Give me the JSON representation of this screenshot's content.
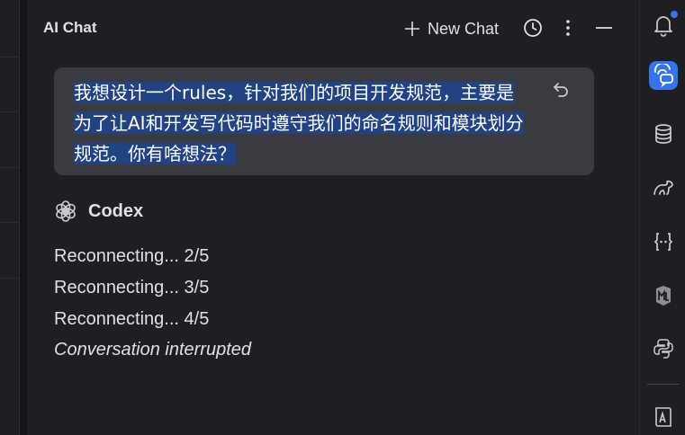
{
  "panel": {
    "title": "AI Chat",
    "new_chat_label": "New Chat"
  },
  "conversation": {
    "user_message": "我想设计一个rules，针对我们的项目开发规范，主要是为了让AI和开发写代码时遵守我们的命名规则和模块划分规范。你有啥想法？",
    "assistant_name": "Codex",
    "status_lines": [
      "Reconnecting... 2/5",
      "Reconnecting... 3/5",
      "Reconnecting... 4/5"
    ],
    "interrupted": "Conversation interrupted"
  },
  "colors": {
    "accent": "#3574f0",
    "selection": "#214283",
    "bubble": "#393b40",
    "background": "#1e1f22"
  },
  "right_toolbar": [
    "notifications-icon",
    "ai-chat-icon",
    "database-icon",
    "gradle-icon",
    "json-icon",
    "markdown-icon",
    "python-icon",
    "reader-mode-icon"
  ]
}
